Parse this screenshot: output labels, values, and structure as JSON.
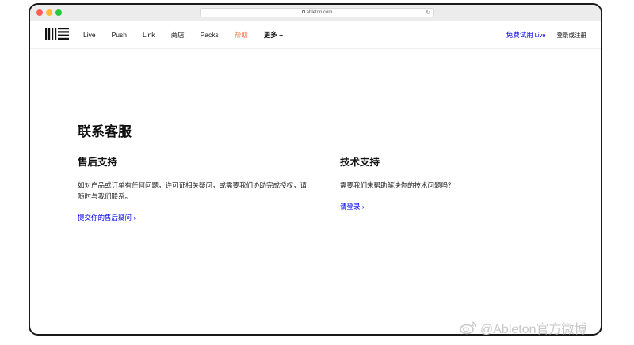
{
  "browser": {
    "url": "ableton.com",
    "reload_glyph": "↻"
  },
  "nav": {
    "items": [
      {
        "label": "Live"
      },
      {
        "label": "Push"
      },
      {
        "label": "Link"
      },
      {
        "label": "商店"
      },
      {
        "label": "Packs"
      },
      {
        "label": "帮助"
      },
      {
        "label": "更多 +"
      }
    ],
    "trial_label": "免费试用",
    "trial_live": "Live",
    "login_label": "登录或注册"
  },
  "page": {
    "title": "联系客服"
  },
  "support": {
    "heading": "售后支持",
    "text": "如对产品或订单有任何问题，许可证相关疑问，或需要我们协助完成授权，请随时与我们联系。",
    "link": "提交你的售后疑问 ›"
  },
  "tech": {
    "heading": "技术支持",
    "text": "需要我们来帮助解决你的技术问题吗？",
    "link": "请登录 ›"
  },
  "watermark": {
    "text": "@Ableton官方微博"
  },
  "colors": {
    "accent_active": "#ff764d",
    "link": "#0000ee"
  }
}
